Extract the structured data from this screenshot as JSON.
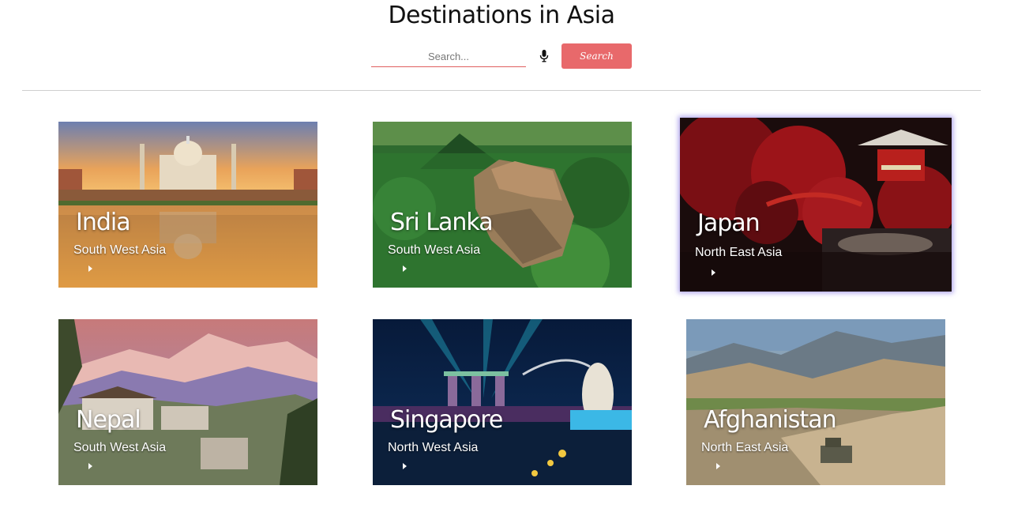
{
  "header": {
    "title": "Destinations in Asia"
  },
  "search": {
    "placeholder": "Search...",
    "button_label": "Search"
  },
  "icons": {
    "mic": "microphone-icon",
    "play": "play-icon"
  },
  "colors": {
    "accent": "#e8696b",
    "featured_glow": "#6e5adc"
  },
  "destinations": [
    {
      "name": "India",
      "region": "South West Asia"
    },
    {
      "name": "Sri Lanka",
      "region": "South West Asia"
    },
    {
      "name": "Japan",
      "region": "North East Asia"
    },
    {
      "name": "Nepal",
      "region": "South West Asia"
    },
    {
      "name": "Singapore",
      "region": "North West Asia"
    },
    {
      "name": "Afghanistan",
      "region": "North East Asia"
    }
  ]
}
